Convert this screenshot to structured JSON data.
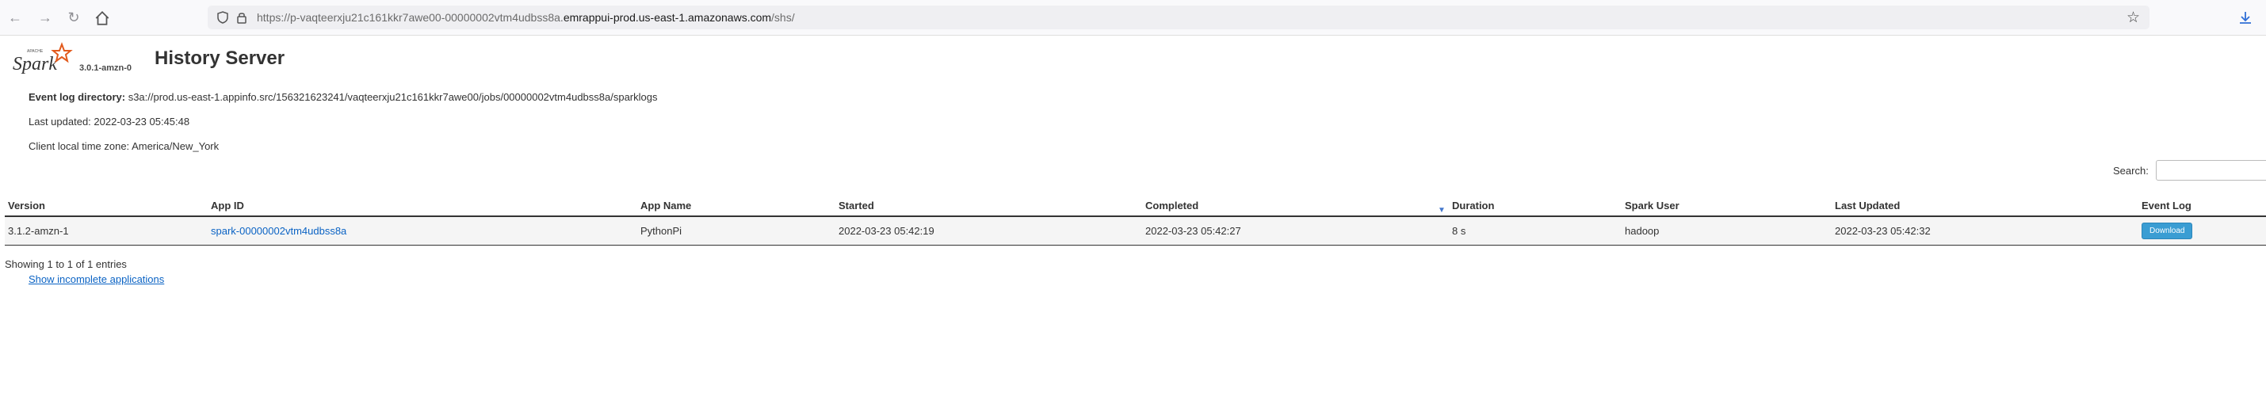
{
  "browser": {
    "url_prefix": "https://p-vaqteerxju21c161kkr7awe00-00000002vtm4udbss8a.",
    "url_host": "emrappui-prod.us-east-1.amazonaws.com",
    "url_path": "/shs/"
  },
  "header": {
    "logo_text": "Spark",
    "logo_small": "APACHE",
    "version": "3.0.1-amzn-0",
    "title": "History Server"
  },
  "info": {
    "event_log_label": "Event log directory:",
    "event_log_value": "s3a://prod.us-east-1.appinfo.src/156321623241/vaqteerxju21c161kkr7awe00/jobs/00000002vtm4udbss8a/sparklogs",
    "last_updated": "Last updated: 2022-03-23 05:45:48",
    "timezone": "Client local time zone: America/New_York"
  },
  "search": {
    "label": "Search:"
  },
  "table": {
    "headers": [
      "Version",
      "App ID",
      "App Name",
      "Started",
      "Completed",
      "Duration",
      "Spark User",
      "Last Updated",
      "Event Log"
    ],
    "rows": [
      {
        "version": "3.1.2-amzn-1",
        "app_id": "spark-00000002vtm4udbss8a",
        "app_name": "PythonPi",
        "started": "2022-03-23 05:42:19",
        "completed": "2022-03-23 05:42:27",
        "duration": "8 s",
        "user": "hadoop",
        "last_updated": "2022-03-23 05:42:32",
        "event_log": "Download"
      }
    ]
  },
  "footer": {
    "entries": "Showing 1 to 1 of 1 entries",
    "incomplete_link": "Show incomplete applications"
  },
  "colors": {
    "link": "#0b63c4",
    "button": "#3a9dd3",
    "logo_orange": "#e25a1c"
  }
}
